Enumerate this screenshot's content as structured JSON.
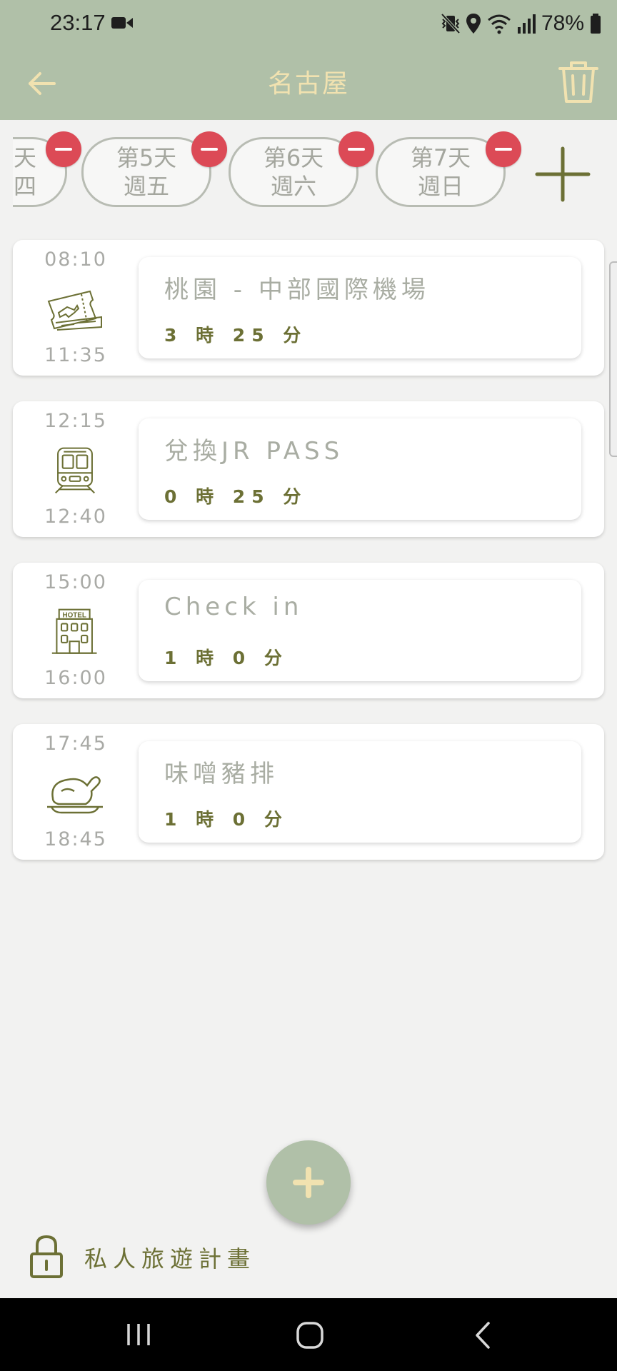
{
  "status_bar": {
    "time": "23:17",
    "battery": "78%"
  },
  "app_bar": {
    "title": "名古屋"
  },
  "day_tabs": [
    {
      "day": "天",
      "weekday": "四"
    },
    {
      "day": "第5天",
      "weekday": "週五"
    },
    {
      "day": "第6天",
      "weekday": "週六"
    },
    {
      "day": "第7天",
      "weekday": "週日"
    }
  ],
  "items": [
    {
      "start": "08:10",
      "end": "11:35",
      "title": "桃園 - 中部國際機場",
      "duration": "3 時 25 分",
      "icon": "plane-ticket-icon"
    },
    {
      "start": "12:15",
      "end": "12:40",
      "title": "兌換JR PASS",
      "duration": "0 時 25 分",
      "icon": "train-icon"
    },
    {
      "start": "15:00",
      "end": "16:00",
      "title": "Check in",
      "duration": "1 時 0 分",
      "icon": "hotel-icon",
      "icon_label": "HOTEL"
    },
    {
      "start": "17:45",
      "end": "18:45",
      "title": "味噌豬排",
      "duration": "1 時 0 分",
      "icon": "roast-chicken-icon"
    }
  ],
  "footer": {
    "private_label": "私人旅遊計畫"
  },
  "colors": {
    "accent": "#b0c0a8",
    "title": "#f1e2b0",
    "olive": "#6c7035",
    "badge_red": "#dc4a56"
  }
}
